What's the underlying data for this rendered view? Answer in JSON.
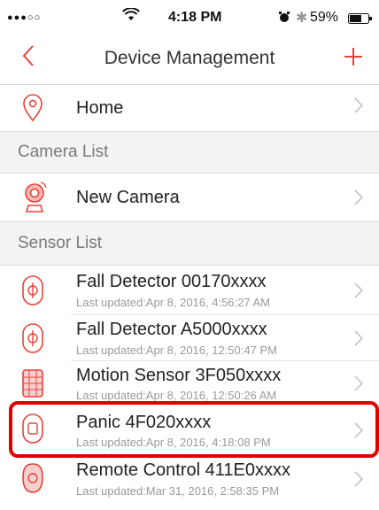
{
  "status_bar": {
    "carrier_signal": "●●●○○",
    "time": "4:18 PM",
    "battery": "59%"
  },
  "header": {
    "title": "Device Management",
    "back_icon": "chevron-left-icon",
    "add_icon": "plus-icon"
  },
  "home": {
    "label": "Home",
    "icon": "location-pin-icon"
  },
  "camera_section": {
    "label": "Camera List"
  },
  "cameras": [
    {
      "name": "New Camera",
      "icon": "webcam-icon"
    }
  ],
  "sensor_section": {
    "label": "Sensor List"
  },
  "sensors": [
    {
      "name": "Fall Detector 00170xxxx",
      "updated": "Last updated:Apr 8, 2016, 4:56:27 AM",
      "icon": "fall-detector-icon"
    },
    {
      "name": "Fall Detector A5000xxxx",
      "updated": "Last updated:Apr 8, 2016, 12:50:47 PM",
      "icon": "fall-detector-icon"
    },
    {
      "name": "Motion Sensor 3F050xxxx",
      "updated": "Last updated:Apr 8, 2016, 12:50:26 AM",
      "icon": "motion-sensor-icon"
    },
    {
      "name": "Panic 4F020xxxx",
      "updated": "Last updated:Apr 8, 2016, 4:18:08 PM",
      "icon": "panic-button-icon"
    },
    {
      "name": "Remote Control 411E0xxxx",
      "updated": "Last updated:Mar 31, 2016, 2:58:35 PM",
      "icon": "remote-control-icon"
    }
  ],
  "colors": {
    "accent": "#e8413a",
    "highlight": "#e00000"
  }
}
